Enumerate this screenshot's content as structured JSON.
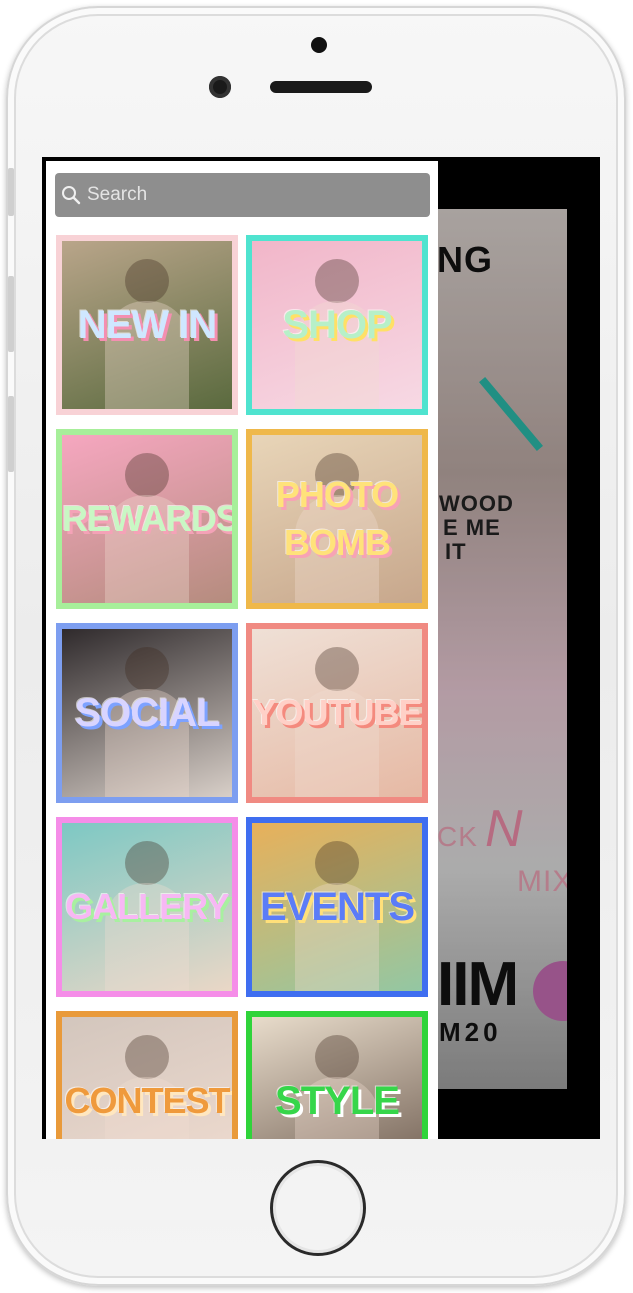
{
  "search": {
    "placeholder": "Search"
  },
  "background_app": {
    "fragment_top": "NG",
    "shirt_text_1": "WOOD",
    "shirt_text_2": "E ME",
    "shirt_text_3": "IT",
    "mix_text_1": "CK",
    "mix_text_2": "N",
    "mix_text_3": "MIX",
    "promo_big": "IIM",
    "promo_code": "M20"
  },
  "tiles": [
    {
      "label": "NEW IN",
      "text_color": "#cfe7ff",
      "shadow_color": "#f48fb1",
      "border_color": "#f8d2d6",
      "bg_from": "#b9a58a",
      "bg_to": "#5a6a3e"
    },
    {
      "label": "SHOP",
      "text_color": "#b7f0c8",
      "shadow_color": "#ffe066",
      "border_color": "#4fe3cf",
      "bg_from": "#f1b6c9",
      "bg_to": "#f7d9e4"
    },
    {
      "label": "REWARDS",
      "text_color": "#c9f7c4",
      "shadow_color": "#f4a2b7",
      "border_color": "#a7ef9a",
      "bg_from": "#f6a7c0",
      "bg_to": "#b58c7e"
    },
    {
      "label": "PHOTO BOMB",
      "text_color": "#ffe27a",
      "shadow_color": "#f7a3b5",
      "border_color": "#efb84a",
      "bg_from": "#e8d5b8",
      "bg_to": "#c7a78c"
    },
    {
      "label": "SOCIAL",
      "text_color": "#d8d4ff",
      "shadow_color": "#7da2ff",
      "border_color": "#7d9ef0",
      "bg_from": "#2f2a2c",
      "bg_to": "#d8cfc8"
    },
    {
      "label": "YOUTUBE",
      "text_color": "#ffd0c7",
      "shadow_color": "#f48a7e",
      "border_color": "#f08a82",
      "bg_from": "#efe0d6",
      "bg_to": "#e6b9a4"
    },
    {
      "label": "GALLERY",
      "text_color": "#f7b8f4",
      "shadow_color": "#a8f0a0",
      "border_color": "#f58de8",
      "bg_from": "#7dc8c4",
      "bg_to": "#ead7c6"
    },
    {
      "label": "EVENTS",
      "text_color": "#5b7cf7",
      "shadow_color": "#ffe07a",
      "border_color": "#3f6ef0",
      "bg_from": "#e8b05a",
      "bg_to": "#93c7a3"
    },
    {
      "label": "CONTEST",
      "text_color": "#ef9a3c",
      "shadow_color": "#ffe7c0",
      "border_color": "#e99a3a",
      "bg_from": "#d3c6bd",
      "bg_to": "#f0dcd0"
    },
    {
      "label": "STYLE",
      "text_color": "#36d64a",
      "shadow_color": "#ffffff",
      "border_color": "#2fd43a",
      "bg_from": "#e8dccb",
      "bg_to": "#6c5a4e"
    }
  ]
}
